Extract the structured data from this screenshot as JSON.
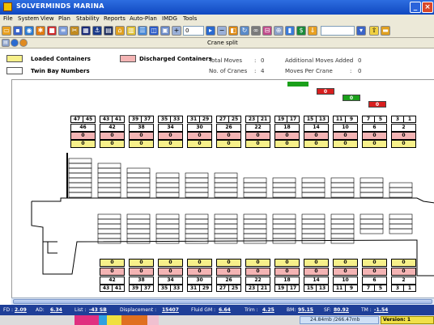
{
  "window": {
    "title": "SOLVERMINDS MARINA"
  },
  "menu": [
    "File",
    "System",
    "View",
    "Plan",
    "Stability",
    "Reports",
    "Auto-Plan",
    "IMDG",
    "Tools"
  ],
  "toolbar": {
    "zoom_value": "0",
    "combo_value": ""
  },
  "panel": {
    "title": "Crane split"
  },
  "legend": {
    "loaded": "Loaded Containers",
    "discharged": "Discharged Containers",
    "twin": "Twin Bay Numbers",
    "colors": {
      "loaded": "#f7f08a",
      "discharged": "#f4b4b4",
      "twin": "#ffffff"
    }
  },
  "stats": {
    "total_moves_label": "Total Moves",
    "total_moves": "0",
    "cranes_label": "No. of Cranes",
    "cranes": "4",
    "additional_label": "Additional Moves Added",
    "additional": "0",
    "per_crane_label": "Moves Per Crane",
    "per_crane": "0",
    "sep": ":"
  },
  "bays": [
    {
      "pair": [
        "47",
        "45"
      ],
      "bay": "46",
      "dis_top": "0",
      "load_top": "0",
      "load_bot": "",
      "dis_bot": ""
    },
    {
      "pair": [
        "43",
        "41"
      ],
      "bay": "42",
      "dis_top": "0",
      "load_top": "0",
      "load_bot": "0",
      "dis_bot": "0"
    },
    {
      "pair": [
        "39",
        "37"
      ],
      "bay": "38",
      "dis_top": "0",
      "load_top": "0",
      "load_bot": "0",
      "dis_bot": "0"
    },
    {
      "pair": [
        "35",
        "33"
      ],
      "bay": "34",
      "dis_top": "0",
      "load_top": "0",
      "load_bot": "0",
      "dis_bot": "0"
    },
    {
      "pair": [
        "31",
        "29"
      ],
      "bay": "30",
      "dis_top": "0",
      "load_top": "0",
      "load_bot": "0",
      "dis_bot": "0"
    },
    {
      "pair": [
        "27",
        "25"
      ],
      "bay": "26",
      "dis_top": "0",
      "load_top": "0",
      "load_bot": "0",
      "dis_bot": "0"
    },
    {
      "pair": [
        "23",
        "21"
      ],
      "bay": "22",
      "dis_top": "0",
      "load_top": "0",
      "load_bot": "0",
      "dis_bot": "0"
    },
    {
      "pair": [
        "19",
        "17"
      ],
      "bay": "18",
      "dis_top": "0",
      "load_top": "0",
      "load_bot": "0",
      "dis_bot": "0"
    },
    {
      "pair": [
        "15",
        "13"
      ],
      "bay": "14",
      "dis_top": "0",
      "load_top": "0",
      "load_bot": "0",
      "dis_bot": "0"
    },
    {
      "pair": [
        "11",
        "9"
      ],
      "bay": "10",
      "dis_top": "0",
      "load_top": "0",
      "load_bot": "0",
      "dis_bot": "0"
    },
    {
      "pair": [
        "7",
        "5"
      ],
      "bay": "6",
      "dis_top": "0",
      "load_top": "0",
      "load_bot": "0",
      "dis_bot": "0"
    },
    {
      "pair": [
        "3",
        "1"
      ],
      "bay": "2",
      "dis_top": "0",
      "load_top": "0",
      "load_bot": "0",
      "dis_bot": "0"
    }
  ],
  "cranes": [
    {
      "tag": "0",
      "color": "#d81e1e"
    },
    {
      "tag": "0",
      "color": "#1aa01a"
    },
    {
      "tag": "0",
      "color": "#d81e1e"
    }
  ],
  "status": {
    "fd_label": "FD :",
    "fd": "2.09",
    "ad_label": "AD:",
    "ad": "6.34",
    "list_label": "List :",
    "list": "-43 SB",
    "disp_label": "Displacement :",
    "disp": "15407",
    "fgm_label": "Fluid GM :",
    "fgm": "6.64",
    "trim_label": "Trim :",
    "trim": "4.25",
    "bm_label": "BM:",
    "bm": "95.15",
    "sf_label": "SF:",
    "sf": "80.92",
    "tm_label": "TM :",
    "tm": "-1.54"
  },
  "taskbar": {
    "memory": "24.84mb /266.47mb",
    "version": "Version: 1"
  }
}
